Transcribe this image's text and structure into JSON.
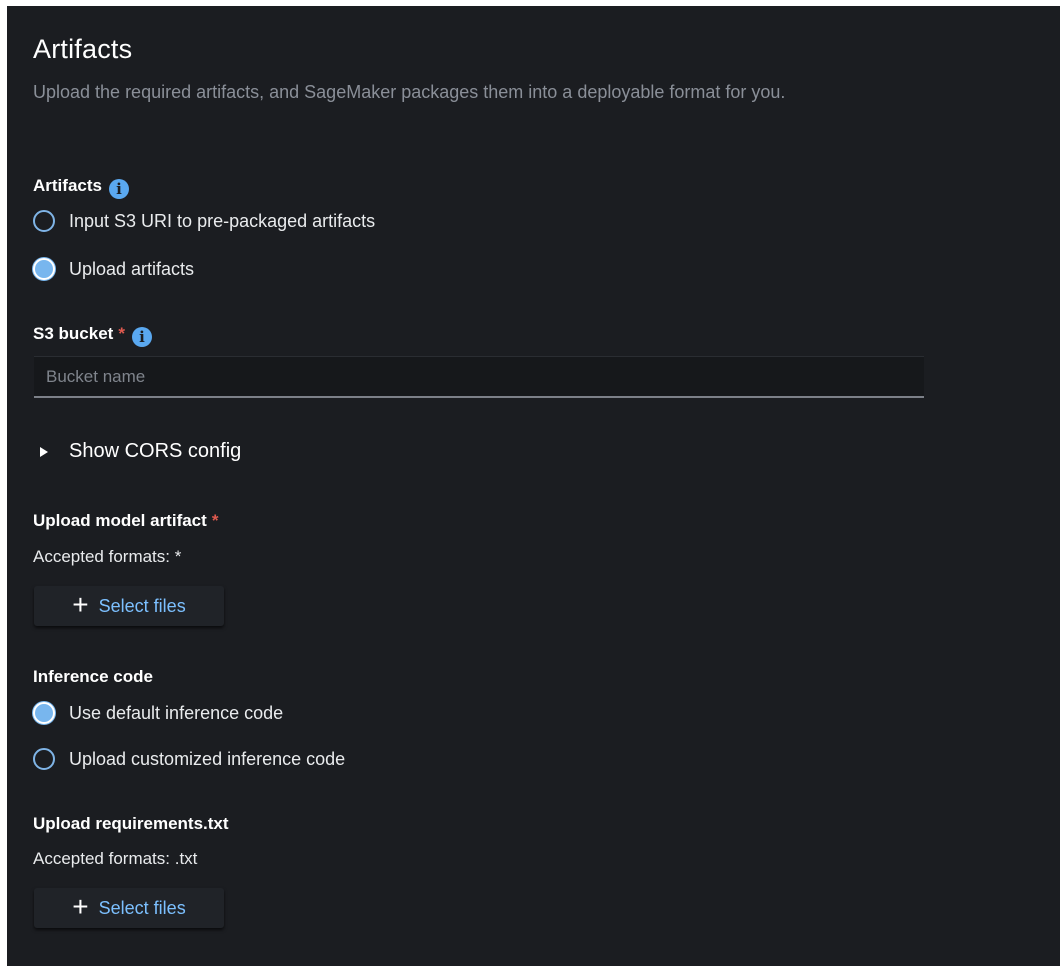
{
  "header": {
    "title": "Artifacts",
    "description": "Upload the required artifacts, and SageMaker packages them into a deployable format for you."
  },
  "artifacts_section": {
    "label": "Artifacts",
    "info_icon": "info-icon",
    "options": [
      {
        "label": "Input S3 URI to pre-packaged artifacts",
        "selected": false
      },
      {
        "label": "Upload artifacts",
        "selected": true
      }
    ]
  },
  "s3_bucket": {
    "label": "S3 bucket",
    "required_marker": "*",
    "info_icon": "info-icon",
    "value": "",
    "placeholder": "Bucket name"
  },
  "cors": {
    "toggle_label": "Show CORS config",
    "expanded": false
  },
  "model_artifact": {
    "label": "Upload model artifact",
    "required_marker": "*",
    "accepted_formats": "Accepted formats: *",
    "button_icon": "+",
    "button_label": "Select files"
  },
  "inference_code": {
    "label": "Inference code",
    "options": [
      {
        "label": "Use default inference code",
        "selected": true
      },
      {
        "label": "Upload customized inference code",
        "selected": false
      }
    ]
  },
  "requirements": {
    "label": "Upload requirements.txt",
    "accepted_formats": "Accepted formats: .txt",
    "button_icon": "+",
    "button_label": "Select files"
  },
  "colors": {
    "background": "#1b1d21",
    "accent": "#78b6ee",
    "link": "#7cc0ff",
    "required": "#e05a4f"
  }
}
